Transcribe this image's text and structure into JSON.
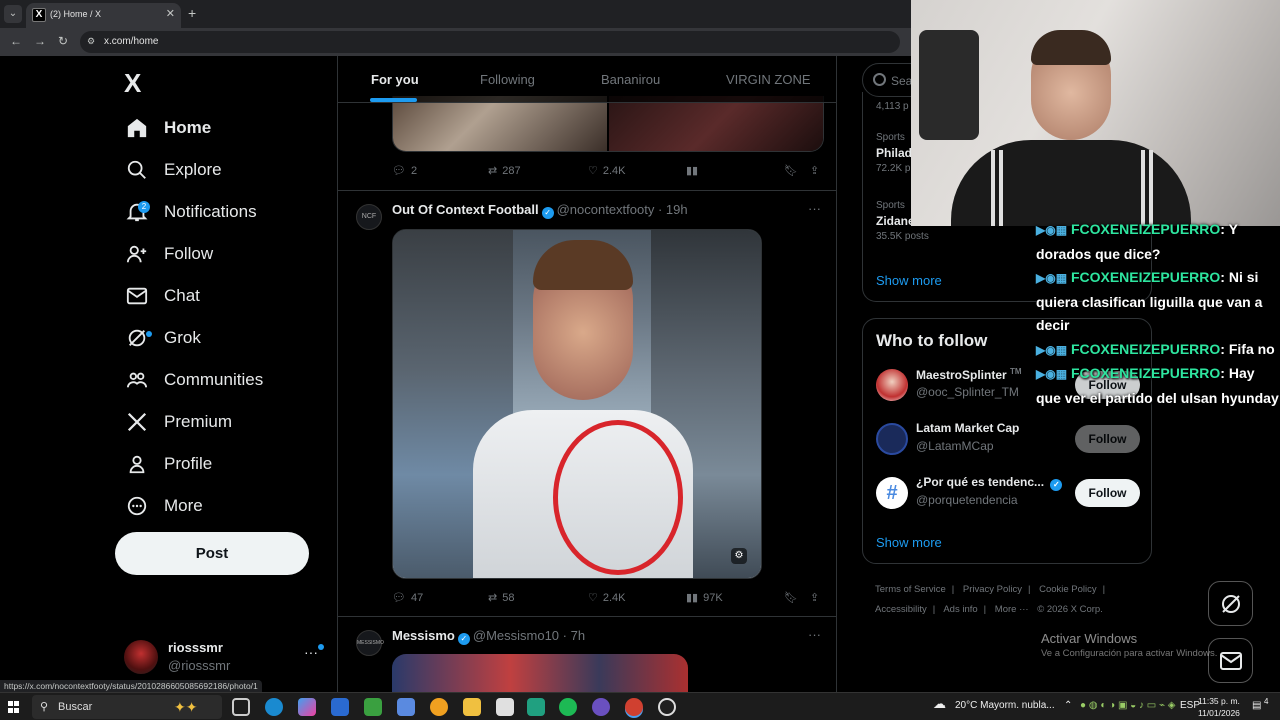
{
  "browser": {
    "tab_title": "(2) Home / X",
    "url": "x.com/home",
    "status_url": "https://x.com/nocontextfooty/status/2010286605085692186/photo/1"
  },
  "sidebar": {
    "logo": "X",
    "items": [
      {
        "label": "Home",
        "icon": "home-icon"
      },
      {
        "label": "Explore",
        "icon": "search-icon"
      },
      {
        "label": "Notifications",
        "icon": "bell-icon",
        "badge": "2"
      },
      {
        "label": "Follow",
        "icon": "person-plus-icon"
      },
      {
        "label": "Chat",
        "icon": "envelope-icon"
      },
      {
        "label": "Grok",
        "icon": "grok-icon"
      },
      {
        "label": "Communities",
        "icon": "people-icon"
      },
      {
        "label": "Premium",
        "icon": "x-icon"
      },
      {
        "label": "Profile",
        "icon": "person-icon"
      },
      {
        "label": "More",
        "icon": "more-circle-icon"
      }
    ],
    "post_label": "Post",
    "account": {
      "name": "riosssmr",
      "handle": "@riosssmr",
      "more": "···"
    }
  },
  "timeline": {
    "tabs": [
      "For you",
      "Following",
      "Bananirou",
      "VIRGIN ZONE"
    ],
    "tweet1_actions": {
      "replies": "2",
      "reposts": "287",
      "likes": "2.4K"
    },
    "tweet2": {
      "name": "Out Of Context Football",
      "handle": "@nocontextfooty",
      "time": "19h",
      "avatar_text": "NCF",
      "replies": "47",
      "reposts": "58",
      "likes": "2.4K",
      "views": "97K"
    },
    "tweet3": {
      "name": "Messismo",
      "handle": "@Messismo10",
      "time": "7h",
      "avatar_text": "MESSISMO"
    }
  },
  "right": {
    "search_placeholder": "Sea",
    "trends": [
      {
        "category": "",
        "name": "",
        "count": "4,113 p"
      },
      {
        "category": "Sports",
        "name": "Philad",
        "count": "72.2K p"
      },
      {
        "category": "Sports",
        "name": "Zidane",
        "count": "35.5K posts"
      }
    ],
    "show_more": "Show more",
    "who_to_follow": "Who to follow",
    "suggestions": [
      {
        "name": "MaestroSplinter",
        "suffix": "TM",
        "handle": "@ooc_Splinter_TM",
        "follow": "Follow"
      },
      {
        "name": "Latam Market Cap",
        "handle": "@LatamMCap",
        "follow": "Follow"
      },
      {
        "name": "¿Por qué es tendenc...",
        "handle": "@porquetendencia",
        "follow": "Follow"
      }
    ],
    "show_more2": "Show more",
    "footer": [
      "Terms of Service",
      "|",
      "Privacy Policy",
      "|",
      "Cookie Policy",
      "|",
      "Accessibility",
      "|",
      "Ads info",
      "|",
      "More ···",
      "© 2026 X Corp."
    ]
  },
  "chat": [
    {
      "user": "FCOXENEIZEPUERRO",
      "msg": ": Y dorados que dice?"
    },
    {
      "user": "FCOXENEIZEPUERRO",
      "msg": ": Ni si quiera clasifican liguilla que van a decir"
    },
    {
      "user": "FCOXENEIZEPUERRO",
      "msg": ": Fifa no"
    },
    {
      "user": "FCOXENEIZEPUERRO",
      "msg": ": Hay que ver el partido del ulsan hyunday"
    }
  ],
  "activate": {
    "title": "Activar Windows",
    "subtitle": "Ve a Configuración para activar Windows."
  },
  "taskbar": {
    "search": "Buscar",
    "weather": "20°C  Mayorm. nubla...",
    "lang": "ESP",
    "time": "11:35 p. m.",
    "date": "11/01/2026",
    "notif": "4"
  }
}
